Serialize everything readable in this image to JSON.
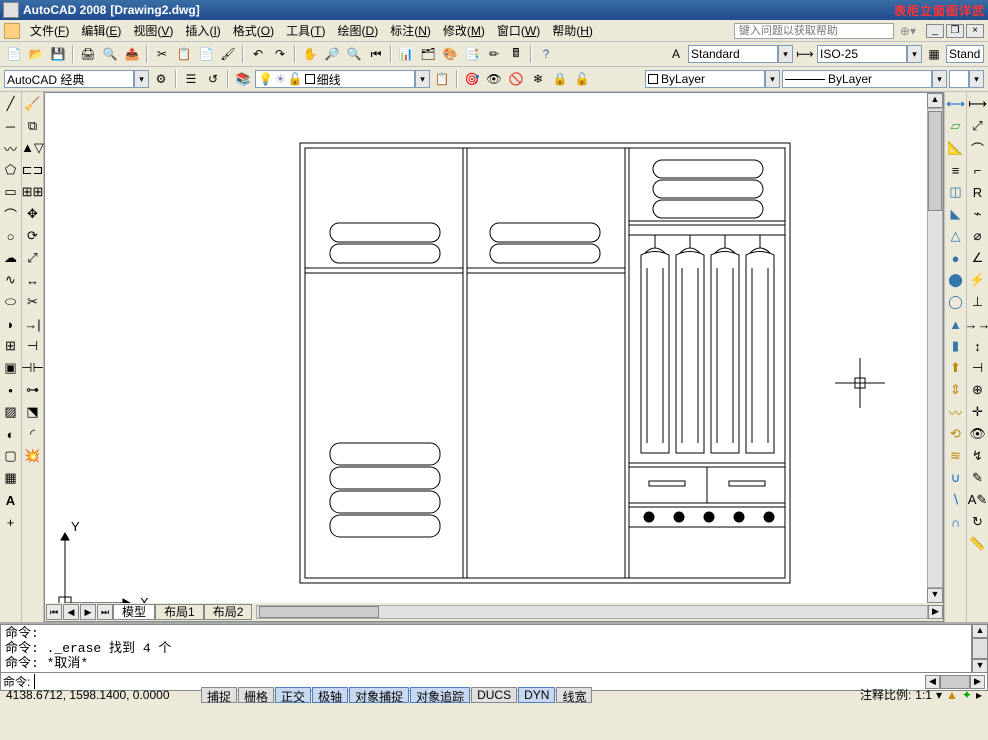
{
  "title": {
    "app": "AutoCAD 2008",
    "doc": "[Drawing2.dwg]",
    "decoration": "表柜立面图详武"
  },
  "menu": {
    "items": [
      {
        "label": "文件",
        "accel": "F"
      },
      {
        "label": "编辑",
        "accel": "E"
      },
      {
        "label": "视图",
        "accel": "V"
      },
      {
        "label": "插入",
        "accel": "I"
      },
      {
        "label": "格式",
        "accel": "O"
      },
      {
        "label": "工具",
        "accel": "T"
      },
      {
        "label": "绘图",
        "accel": "D"
      },
      {
        "label": "标注",
        "accel": "N"
      },
      {
        "label": "修改",
        "accel": "M"
      },
      {
        "label": "窗口",
        "accel": "W"
      },
      {
        "label": "帮助",
        "accel": "H"
      }
    ],
    "help_placeholder": "键入问题以获取帮助"
  },
  "toolbars": {
    "row1_icons": [
      "new",
      "open",
      "save",
      "print",
      "plot-preview",
      "publish",
      "cut",
      "copy",
      "paste",
      "match",
      "undo",
      "redo",
      "pan",
      "zoom-rt",
      "zoom-prev",
      "props",
      "dc",
      "tool-pal",
      "sheet",
      "markup",
      "calc",
      "help"
    ],
    "text_style": "Standard",
    "dim_style": "ISO-25",
    "table_style": "Standard",
    "workspace": "AutoCAD 经典",
    "layer_icons": [
      "filter",
      "prev",
      "state",
      "freeze",
      "lock",
      "color",
      "vp"
    ],
    "layer_combo_text": "细线",
    "color_combo": "ByLayer",
    "linetype_combo": "ByLayer"
  },
  "draw_tools": [
    "line",
    "cline",
    "pline",
    "polygon",
    "rect",
    "arc",
    "circle",
    "rev-cloud",
    "spline",
    "ellipse",
    "e-arc",
    "block",
    "point",
    "hatch",
    "grad",
    "region",
    "table",
    "mtext",
    "add"
  ],
  "modify_tools": [
    "erase",
    "copy",
    "mirror",
    "offset",
    "array",
    "move",
    "rotate",
    "scale",
    "stretch",
    "trim",
    "extend",
    "break-pt",
    "break",
    "join",
    "chamfer",
    "fillet",
    "explode"
  ],
  "right_tools_top": [
    "dist",
    "area",
    "list",
    "locate",
    "3d-box",
    "3d-wedge",
    "3d-cone",
    "3d-sphere",
    "3d-cyl",
    "3d-torus",
    "3d-pyr",
    "extrude",
    "rev",
    "sweep",
    "loft",
    "press",
    "union",
    "subtract",
    "intersect",
    "slice"
  ],
  "right_tools2": [
    "dim-lin",
    "dim-align",
    "dim-arc",
    "dim-ord",
    "dim-rad",
    "dim-jog",
    "dim-dia",
    "dim-ang",
    "dim-quick",
    "dim-base",
    "dim-cont",
    "dim-space",
    "dim-break",
    "tol",
    "center",
    "inspect",
    "jog-lin",
    "edit",
    "tedit",
    "update",
    "style"
  ],
  "tabs": {
    "active": "模型",
    "layout1": "布局1",
    "layout2": "布局2"
  },
  "command": {
    "line1": "命令:",
    "line2": "命令: ._erase 找到 4 个",
    "line3": "命令: *取消*",
    "prompt": "命令:"
  },
  "status": {
    "coords": "4138.6712, 1598.1400, 0.0000",
    "buttons": [
      "捕捉",
      "栅格",
      "正交",
      "极轴",
      "对象捕捉",
      "对象追踪",
      "DUCS",
      "DYN",
      "线宽"
    ],
    "anno_label": "注释比例:",
    "anno_scale": "1:1"
  }
}
